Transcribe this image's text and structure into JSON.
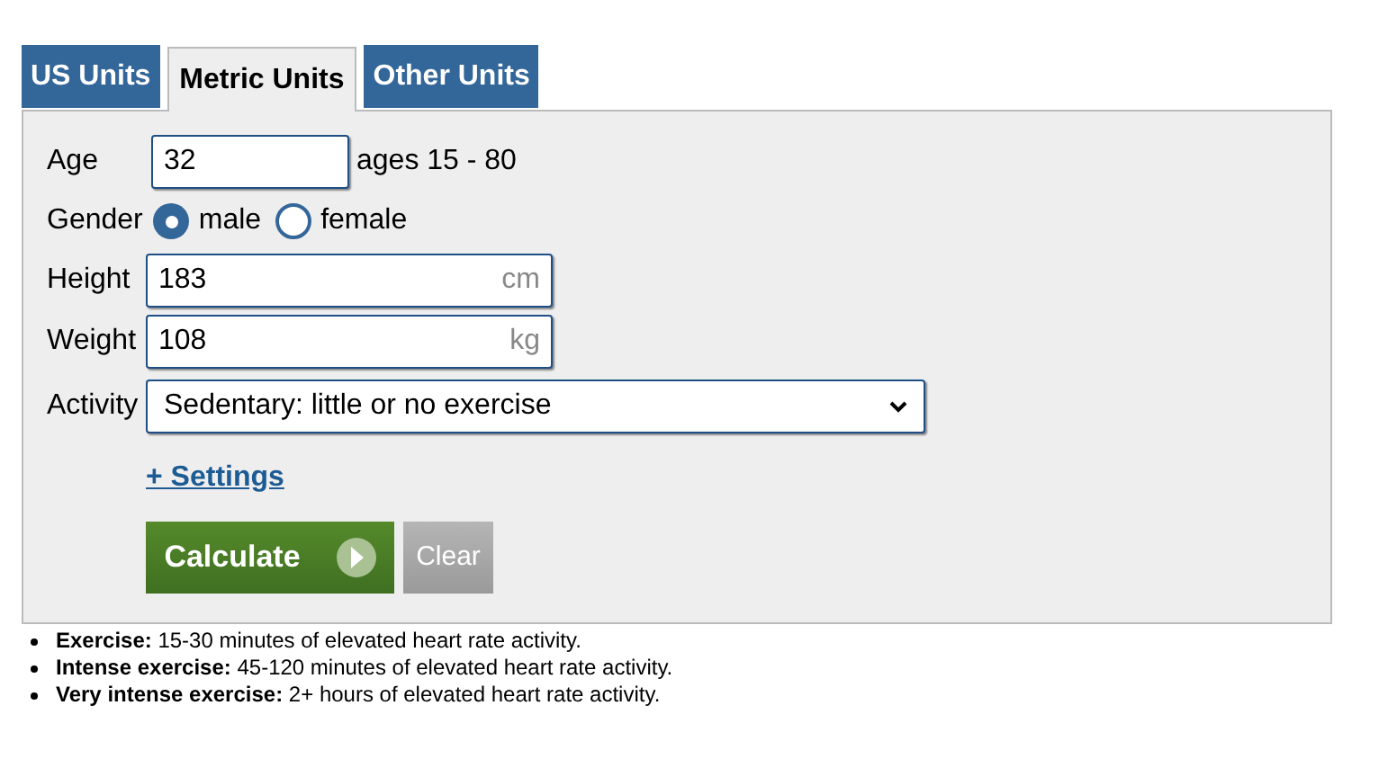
{
  "tabs": [
    {
      "label": "US Units",
      "selected": false
    },
    {
      "label": "Metric Units",
      "selected": true
    },
    {
      "label": "Other Units",
      "selected": false
    }
  ],
  "form": {
    "age": {
      "label": "Age",
      "value": "32",
      "hint": "ages 15 - 80"
    },
    "gender": {
      "label": "Gender",
      "options": [
        {
          "label": "male",
          "selected": true
        },
        {
          "label": "female",
          "selected": false
        }
      ]
    },
    "height": {
      "label": "Height",
      "value": "183",
      "unit": "cm"
    },
    "weight": {
      "label": "Weight",
      "value": "108",
      "unit": "kg"
    },
    "activity": {
      "label": "Activity",
      "value": "Sedentary: little or no exercise"
    },
    "settings_link": "+ Settings",
    "buttons": {
      "calculate": "Calculate",
      "clear": "Clear"
    }
  },
  "notes": [
    "**Exercise:** 15-30 minutes of elevated heart rate activity.",
    "**Intense exercise:** 45-120 minutes of elevated heart rate activity.",
    "**Very intense exercise:** 2+ hours of elevated heart rate activity."
  ]
}
